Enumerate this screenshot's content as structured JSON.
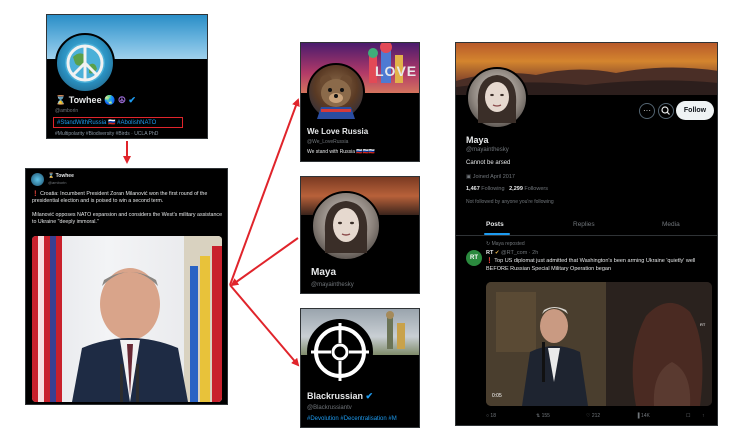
{
  "towhee": {
    "name": "Towhee",
    "handle": "@amborin",
    "highlighted_tags": "#StandWithRussia 🇷🇺 #AbolishNATO",
    "more_tags": "#Multipolarity #Biodiversity #Birds · UCLA PhD"
  },
  "tweet": {
    "author": "Towhee",
    "handle": "@amborin",
    "line1": "Croatia: Incumbent President Zoran Milanović won the first round of the presidential election and is poised to win a second term.",
    "line2": "Milanović opposes NATO expansion and considers the West's military assistance to Ukraine \"deeply immoral.\""
  },
  "we_love_russia": {
    "name": "We Love Russia",
    "handle": "@We_LoveRussia",
    "bio": "We stand with Russia 🇷🇺🇷🇺🇷🇺",
    "banner_text": "LOVE"
  },
  "maya_mid": {
    "name": "Maya",
    "handle": "@mayainthesky"
  },
  "blackrussian": {
    "name": "Blackrussian",
    "handle": "@Blackrussiantv",
    "tags": "#Devolution  #Decentralisation  #M"
  },
  "maya_profile": {
    "name": "Maya",
    "handle": "@mayainthesky",
    "bio": "Cannot be arsed",
    "joined": "Joined April 2017",
    "following_count": "1,467",
    "following_label": "Following",
    "followers_count": "2,299",
    "followers_label": "Followers",
    "not_followed": "Not followed by anyone you're following",
    "follow_button": "Follow",
    "more_icon_glyph": "···",
    "tabs": [
      "Posts",
      "Replies",
      "Media"
    ],
    "repost_label": "Maya reposted",
    "rt_avatar": "RT",
    "rt_name": "RT",
    "rt_meta": "@RT_com · 2h",
    "rt_text": "Top US diplomat just admitted that Washington's been arming Ukraine 'quietly' well BEFORE Russian Special Military Operation began",
    "video_time": "0:05",
    "video_watermark": "RT",
    "actions": {
      "replies": "18",
      "reposts": "155",
      "likes": "212",
      "views": "14K"
    }
  },
  "colors": {
    "arrow": "#e0242b",
    "accent": "#1d9bf0",
    "card_bg": "#000000",
    "follow_bg": "#eff3f4"
  }
}
